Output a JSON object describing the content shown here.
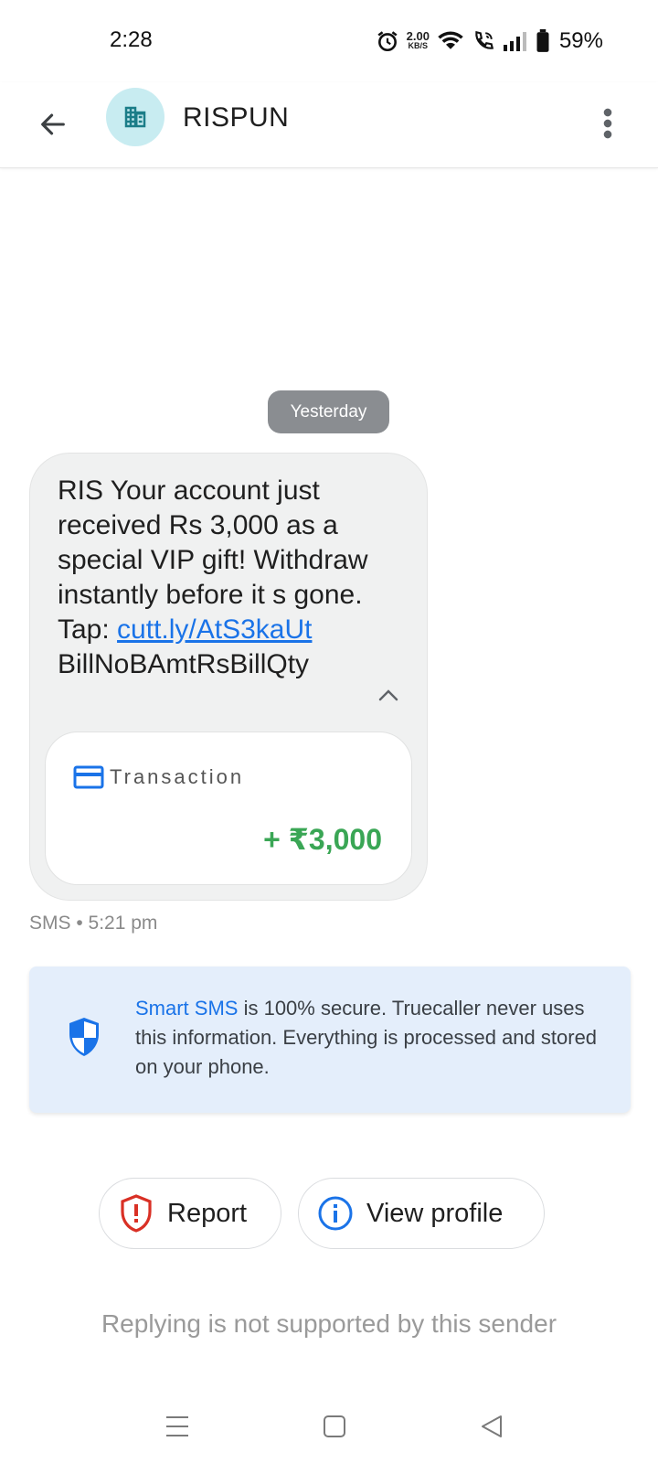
{
  "status_bar": {
    "time": "2:28",
    "net_speed_value": "2.00",
    "net_speed_unit": "KB/S",
    "battery": "59%",
    "icons": [
      "alarm-icon",
      "wifi-icon",
      "wifi-call-icon",
      "signal-icon",
      "battery-icon"
    ]
  },
  "header": {
    "title": "RISPUN",
    "avatar_icon": "building-icon",
    "back_icon": "arrow-left-icon",
    "more_icon": "more-vert-icon"
  },
  "conversation": {
    "date_label": "Yesterday",
    "message": {
      "text_before_link": "RIS Your account just received Rs 3,000 as a special VIP gift! Withdraw instantly before it s gone. Tap: ",
      "link": "cutt.ly/AtS3kaUt",
      "text_after_link": "BillNoBAmtRsBillQty",
      "meta": "SMS • 5:21 pm"
    },
    "transaction": {
      "label": "Transaction",
      "amount": "+ ₹3,000"
    }
  },
  "info_card": {
    "highlight": "Smart SMS",
    "text": " is 100% secure. Truecaller never uses this information. Everything is processed and stored on your phone."
  },
  "actions": {
    "report_label": "Report",
    "view_profile_label": "View profile"
  },
  "footer": {
    "note": "Replying is not supported by this sender"
  },
  "colors": {
    "accent": "#1a73e8",
    "amount": "#3aa655",
    "report_icon": "#d93025",
    "avatar_bg": "#c8ecf1",
    "avatar_icon": "#1b7d88",
    "info_bg": "#e4eefb"
  }
}
